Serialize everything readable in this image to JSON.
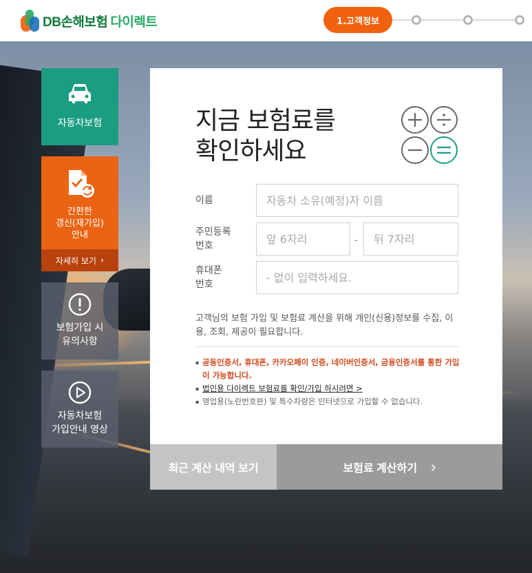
{
  "header": {
    "logo_text": "DB손해보험",
    "logo_sub": "다이렉트",
    "steps": [
      {
        "label": "1.고객정보",
        "active": true
      },
      {
        "label": "",
        "active": false
      },
      {
        "label": "",
        "active": false
      },
      {
        "label": "",
        "active": false
      }
    ],
    "accent_color": "#f0620f"
  },
  "sidebar": {
    "items": [
      {
        "label": "자동차보험",
        "icon": "car-icon",
        "color": "#1b9d82"
      },
      {
        "label": "간편한\n갱신(재가입)\n안내",
        "icon": "document-renew-icon",
        "color": "#ea6413",
        "more_label": "자세히 보기"
      },
      {
        "label": "보험가입 시\n유의사항",
        "icon": "exclamation-icon"
      },
      {
        "label": "자동차보험\n가입안내 영상",
        "icon": "play-icon"
      }
    ]
  },
  "form": {
    "title_line1": "지금 보험료를",
    "title_line2": "확인하세요",
    "icons": [
      "plus-icon",
      "divide-icon",
      "minus-icon",
      "equals-icon"
    ],
    "name_label": "이름",
    "name_placeholder": "자동차 소유(예정)자 이름",
    "ssn_label_1": "주민등록",
    "ssn_label_2": "번호",
    "ssn_front_placeholder": "앞 6자리",
    "ssn_sep": "-",
    "ssn_back_placeholder": "뒤 7자리",
    "phone_label_1": "휴대폰",
    "phone_label_2": "번호",
    "phone_placeholder": "- 없이 입력하세요.",
    "notice": "고객님의 보험 가입 및 보험료 계산을 위해 개인(신용)정보를 수집, 이용, 조회, 제공이 필요합니다.",
    "bullets": [
      {
        "text": "공동인증서, 휴대폰, 카카오페이 인증, 네이버인증서, 금융인증서를 통한 가입이 가능합니다.",
        "style": "red"
      },
      {
        "text": "법인용 다이렉트 보험료를 확인/가입 하시려면 >",
        "style": "link"
      },
      {
        "text": "영업용(노란번호판) 및 특수차량은 인터넷으로 가입할 수 없습니다.",
        "style": "gray"
      }
    ]
  },
  "buttons": {
    "recent_label": "최근 계산 내역 보기",
    "calc_label": "보험료 계산하기",
    "calc_arrow": "›"
  }
}
